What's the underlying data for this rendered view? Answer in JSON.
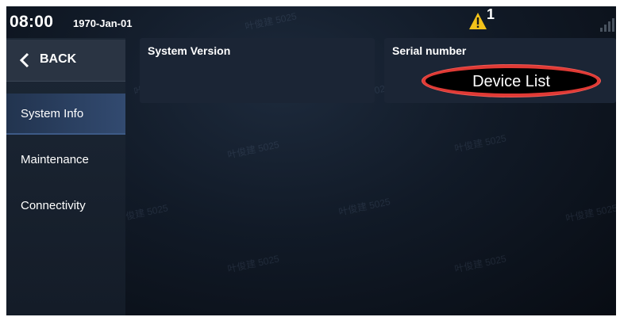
{
  "status_bar": {
    "time": "08:00",
    "date": "1970-Jan-01",
    "warning_count": "1",
    "warning_icon": "warning-triangle-icon",
    "signal_icon": "signal-bars-icon"
  },
  "sidebar": {
    "back_label": "BACK",
    "items": [
      {
        "label": "System Info",
        "active": true
      },
      {
        "label": "Maintenance",
        "active": false
      },
      {
        "label": "Connectivity",
        "active": false
      }
    ]
  },
  "main": {
    "cards": [
      {
        "title": "System Version"
      },
      {
        "title": "Serial number"
      }
    ],
    "device_list_label": "Device List"
  },
  "watermark": {
    "text": "叶俊建 5025"
  },
  "colors": {
    "background": "#0d131d",
    "sidebar": "#1c2735",
    "active_item": "#2c4266",
    "card": "#1b2535",
    "highlight_ring": "#e03a35",
    "warning": "#f2c21a"
  }
}
